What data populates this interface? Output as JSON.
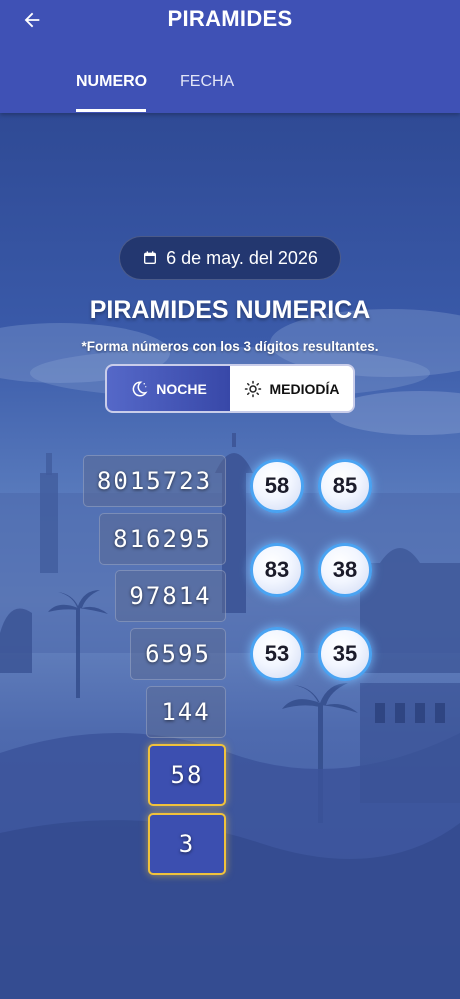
{
  "header": {
    "title": "PIRAMIDES",
    "back_icon": "arrow-left-icon"
  },
  "tabs": [
    {
      "label": "NUMERO",
      "active": true
    },
    {
      "label": "FECHA",
      "active": false
    }
  ],
  "date_selector": {
    "icon": "calendar-icon",
    "value": "6 de may. del 2026"
  },
  "main": {
    "title": "PIRAMIDES NUMERICA",
    "subtitle": "*Forma números con los 3 dígitos resultantes."
  },
  "period_toggle": {
    "options": [
      {
        "label": "NOCHE",
        "icon": "moon-icon",
        "selected": true
      },
      {
        "label": "MEDIODÍA",
        "icon": "sun-icon",
        "selected": false
      }
    ]
  },
  "pyramid": {
    "rows": [
      "8015723",
      "816295",
      "97814",
      "6595",
      "144",
      "58",
      "3"
    ],
    "highlighted_rows": [
      "58",
      "3"
    ]
  },
  "result_pairs": [
    [
      "58",
      "85"
    ],
    [
      "83",
      "38"
    ],
    [
      "53",
      "35"
    ]
  ],
  "colors": {
    "app_bar": "#3f51b5",
    "accent_gold": "#f0c23c",
    "ball_ring": "#4aa3f2"
  }
}
